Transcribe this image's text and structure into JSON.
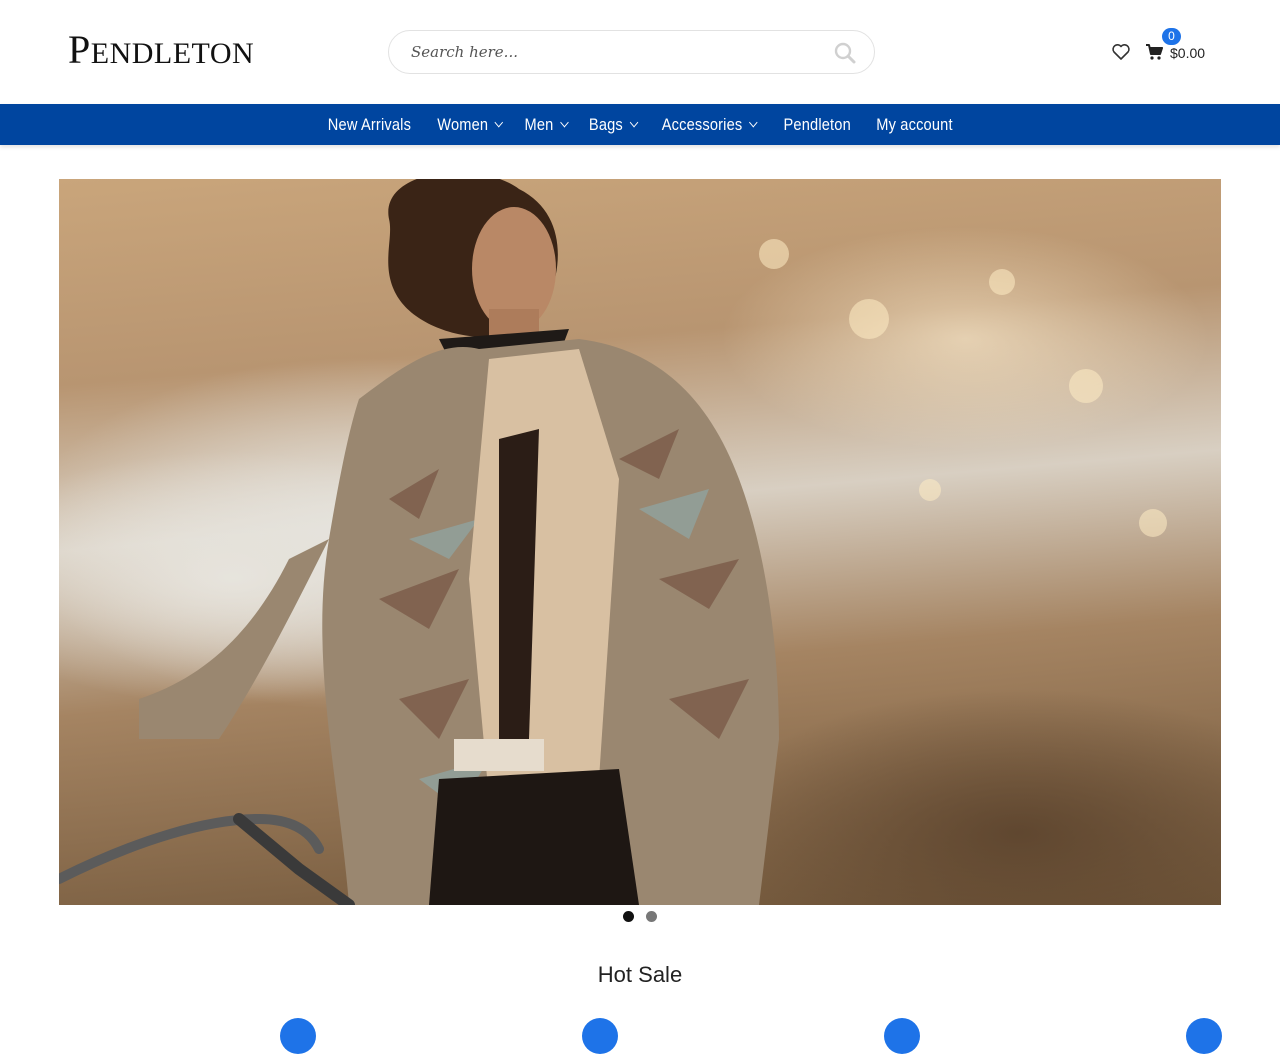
{
  "brand": {
    "logo_text": "Pendleton"
  },
  "search": {
    "placeholder": "Search here...",
    "icon": "search-icon"
  },
  "header_actions": {
    "wishlist_icon": "heart-icon",
    "cart_icon": "cart-icon",
    "cart_count": "0",
    "cart_total": "$0.00"
  },
  "nav": {
    "items": [
      {
        "label": "New Arrivals",
        "has_dropdown": false
      },
      {
        "label": "Women",
        "has_dropdown": true
      },
      {
        "label": "Men",
        "has_dropdown": true
      },
      {
        "label": "Bags",
        "has_dropdown": true
      },
      {
        "label": "Accessories",
        "has_dropdown": true
      },
      {
        "label": "Pendleton",
        "has_dropdown": false
      },
      {
        "label": "My account",
        "has_dropdown": false
      }
    ]
  },
  "hero": {
    "slides_total": 2,
    "active_slide": 1
  },
  "sections": {
    "hot_sale_title": "Hot Sale"
  },
  "colors": {
    "nav_bg": "#00459f",
    "accent": "#1e73e8"
  }
}
